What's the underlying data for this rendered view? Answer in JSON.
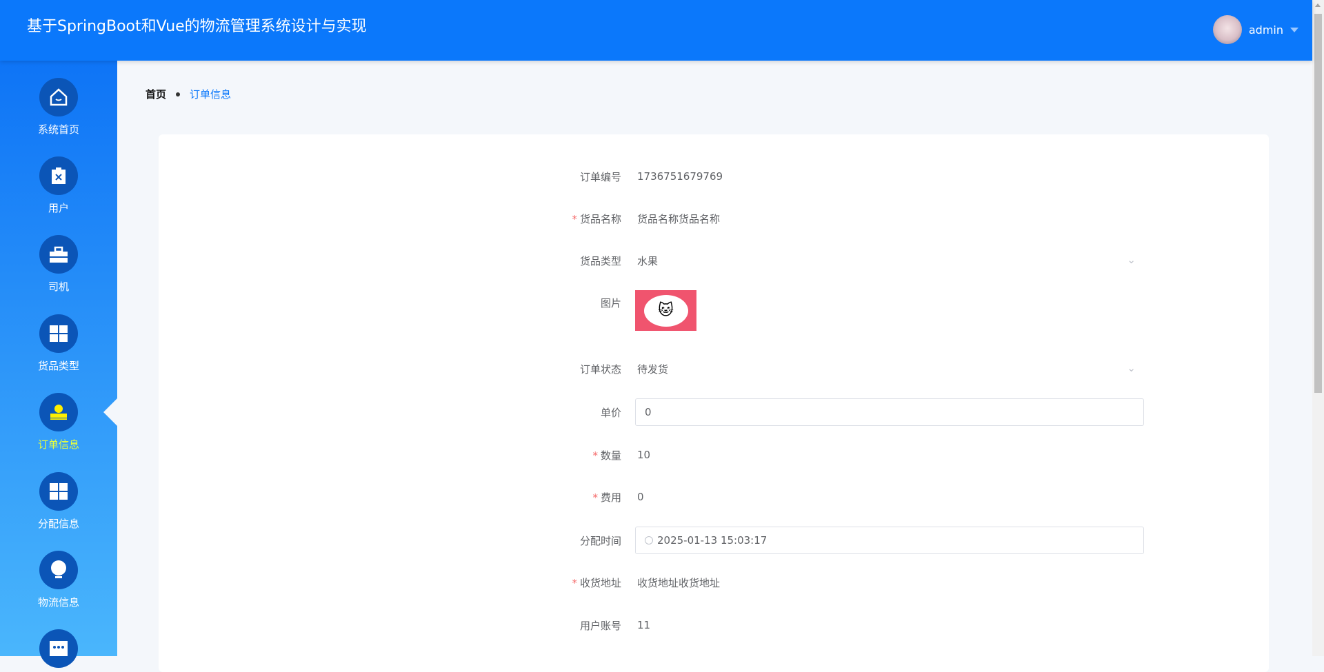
{
  "header": {
    "title": "基于SpringBoot和Vue的物流管理系统设计与实现",
    "username": "admin"
  },
  "sidebar": {
    "items": [
      {
        "label": "系统首页",
        "icon": "home-icon"
      },
      {
        "label": "用户",
        "icon": "clipboard-x-icon"
      },
      {
        "label": "司机",
        "icon": "briefcase-icon"
      },
      {
        "label": "货品类型",
        "icon": "grid-icon"
      },
      {
        "label": "订单信息",
        "icon": "stamp-icon",
        "active": true
      },
      {
        "label": "分配信息",
        "icon": "grid-icon"
      },
      {
        "label": "物流信息",
        "icon": "bulb-icon"
      },
      {
        "label": "",
        "icon": "more-icon"
      }
    ]
  },
  "breadcrumb": {
    "home": "首页",
    "current": "订单信息"
  },
  "form": {
    "order_no": {
      "label": "订单编号",
      "value": "1736751679769"
    },
    "goods_name": {
      "label": "货品名称",
      "value": "货品名称货品名称"
    },
    "goods_type": {
      "label": "货品类型",
      "value": "水果"
    },
    "image": {
      "label": "图片"
    },
    "status": {
      "label": "订单状态",
      "value": "待发货"
    },
    "price": {
      "label": "单价",
      "value": "0"
    },
    "quantity": {
      "label": "数量",
      "value": "10"
    },
    "fee": {
      "label": "费用",
      "value": "0"
    },
    "assign_time": {
      "label": "分配时间",
      "value": "2025-01-13 15:03:17"
    },
    "address": {
      "label": "收货地址",
      "value": "收货地址收货地址"
    },
    "account": {
      "label": "用户账号",
      "value": "11"
    }
  },
  "required_mark": "*"
}
